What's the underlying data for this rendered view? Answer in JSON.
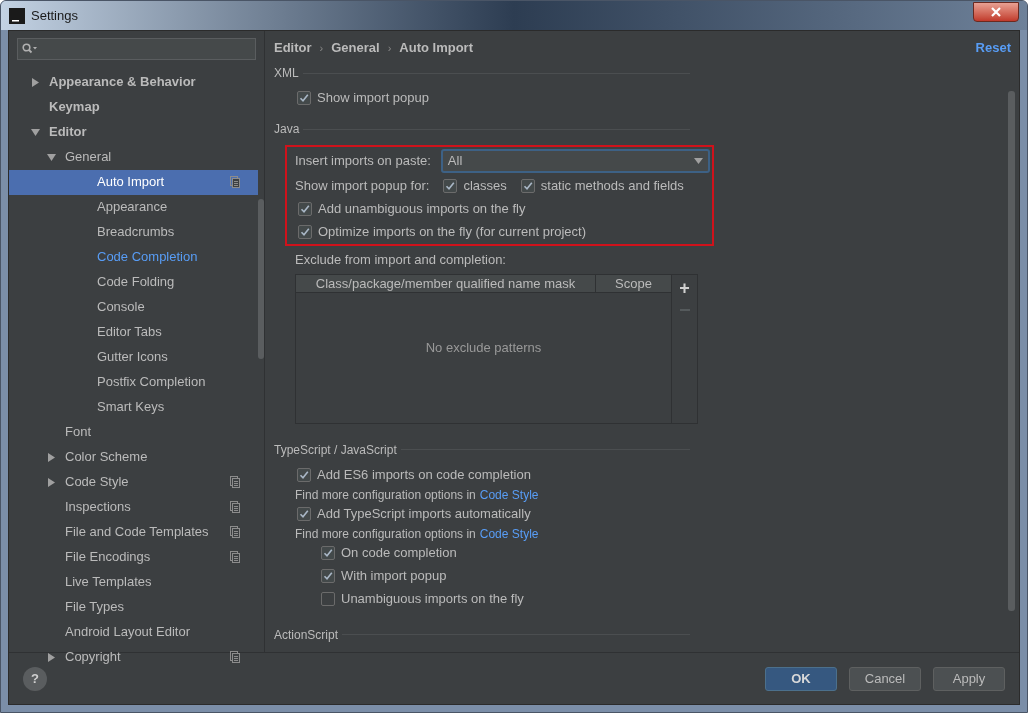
{
  "window": {
    "title": "Settings"
  },
  "tree": [
    {
      "label": "Appearance & Behavior",
      "expanded": false,
      "selected": false,
      "modified": false,
      "project": false
    },
    {
      "label": "Keymap",
      "selected": false,
      "modified": false,
      "project": false
    },
    {
      "label": "Editor",
      "expanded": true,
      "selected": false,
      "modified": false,
      "project": false,
      "children": [
        {
          "label": "General",
          "expanded": true,
          "selected": false,
          "modified": false,
          "project": false,
          "children": [
            {
              "label": "Auto Import",
              "selected": true,
              "modified": false,
              "project": true
            },
            {
              "label": "Appearance",
              "selected": false,
              "modified": false,
              "project": false
            },
            {
              "label": "Breadcrumbs",
              "selected": false,
              "modified": false,
              "project": false
            },
            {
              "label": "Code Completion",
              "selected": false,
              "modified": true,
              "project": false
            },
            {
              "label": "Code Folding",
              "selected": false,
              "modified": false,
              "project": false
            },
            {
              "label": "Console",
              "selected": false,
              "modified": false,
              "project": false
            },
            {
              "label": "Editor Tabs",
              "selected": false,
              "modified": false,
              "project": false
            },
            {
              "label": "Gutter Icons",
              "selected": false,
              "modified": false,
              "project": false
            },
            {
              "label": "Postfix Completion",
              "selected": false,
              "modified": false,
              "project": false
            },
            {
              "label": "Smart Keys",
              "selected": false,
              "modified": false,
              "project": false
            }
          ]
        },
        {
          "label": "Font",
          "selected": false,
          "modified": false,
          "project": false
        },
        {
          "label": "Color Scheme",
          "expanded": false,
          "selected": false,
          "modified": false,
          "project": false
        },
        {
          "label": "Code Style",
          "expanded": false,
          "selected": false,
          "modified": false,
          "project": true
        },
        {
          "label": "Inspections",
          "selected": false,
          "modified": false,
          "project": true
        },
        {
          "label": "File and Code Templates",
          "selected": false,
          "modified": false,
          "project": true
        },
        {
          "label": "File Encodings",
          "selected": false,
          "modified": false,
          "project": true
        },
        {
          "label": "Live Templates",
          "selected": false,
          "modified": false,
          "project": false
        },
        {
          "label": "File Types",
          "selected": false,
          "modified": false,
          "project": false
        },
        {
          "label": "Android Layout Editor",
          "selected": false,
          "modified": false,
          "project": false
        },
        {
          "label": "Copyright",
          "expanded": false,
          "selected": false,
          "modified": false,
          "project": true
        }
      ]
    }
  ],
  "breadcrumb": [
    {
      "kind": "crumb",
      "text": "Editor"
    },
    {
      "kind": "separator",
      "text": "›"
    },
    {
      "kind": "crumb",
      "text": "General"
    },
    {
      "kind": "separator",
      "text": "›"
    },
    {
      "kind": "crumb",
      "text": "Auto Import"
    }
  ],
  "reset": "Reset",
  "xml": {
    "title": "XML",
    "options": [
      {
        "label": "Show import popup",
        "checked": true
      }
    ]
  },
  "java": {
    "title": "Java",
    "paste": {
      "label": "Insert imports on paste:",
      "value": "All"
    },
    "popup": {
      "label": "Show import popup for:",
      "options": [
        {
          "label": "classes",
          "checked": true
        },
        {
          "label": "static methods and fields",
          "checked": true
        }
      ]
    },
    "options": [
      {
        "label": "Add unambiguous imports on the fly",
        "checked": true
      },
      {
        "label": "Optimize imports on the fly (for current project)",
        "checked": true
      }
    ],
    "exclude": {
      "label": "Exclude from import and completion:",
      "columns": [
        "Class/package/member qualified name mask",
        "Scope"
      ],
      "empty": "No exclude patterns",
      "add": "+"
    }
  },
  "typescript": {
    "title": "TypeScript / JavaScript",
    "items": [
      {
        "kind": "checkbox",
        "label": "Add ES6 imports on code completion",
        "checked": true
      },
      {
        "kind": "hint",
        "text": "Find more configuration options in",
        "link": "Code Style"
      },
      {
        "kind": "checkbox",
        "label": "Add TypeScript imports automatically",
        "checked": true
      },
      {
        "kind": "hint",
        "text": "Find more configuration options in",
        "link": "Code Style",
        "children": [
          {
            "kind": "checkbox",
            "label": "On code completion",
            "checked": true
          },
          {
            "kind": "checkbox",
            "label": "With import popup",
            "checked": true
          },
          {
            "kind": "checkbox",
            "label": "Unambiguous imports on the fly",
            "checked": false
          }
        ]
      }
    ]
  },
  "actionscript": {
    "title": "ActionScript"
  },
  "help": "?",
  "buttons": [
    {
      "label": "OK",
      "primary": true
    },
    {
      "label": "Cancel",
      "primary": false
    },
    {
      "label": "Apply",
      "primary": false
    }
  ]
}
